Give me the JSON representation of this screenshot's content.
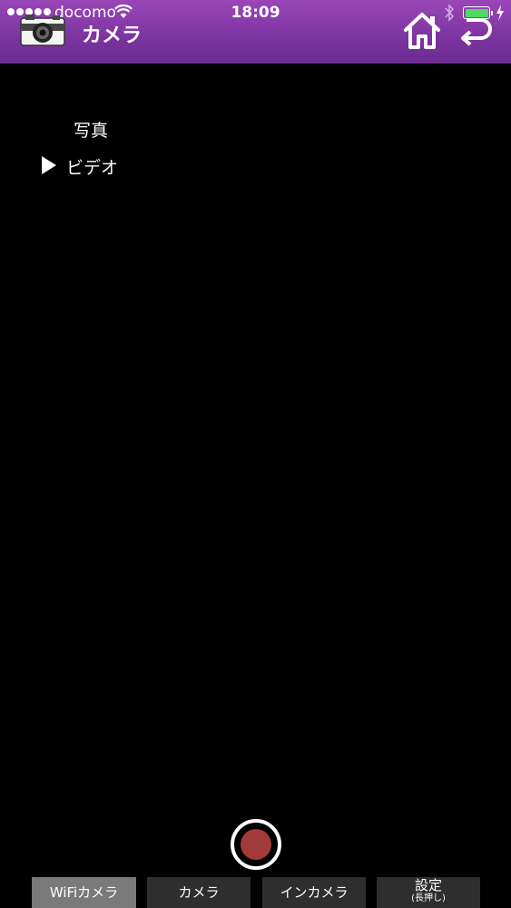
{
  "status_bar": {
    "carrier": "docomo",
    "time": "18:09",
    "battery_level": 1.0,
    "battery_color": "#4cd964"
  },
  "header": {
    "title": "カメラ",
    "background": "#7b34a0",
    "icons": [
      "camera-icon",
      "home-icon",
      "back-icon"
    ]
  },
  "mode_menu": {
    "items": [
      {
        "label": "写真",
        "selected": false
      },
      {
        "label": "ビデオ",
        "selected": true
      }
    ]
  },
  "record_button": {
    "color": "#a33a3a"
  },
  "tabs": [
    {
      "label": "WiFiカメラ",
      "active": true
    },
    {
      "label": "カメラ",
      "active": false
    },
    {
      "label": "インカメラ",
      "active": false
    },
    {
      "label": "設定",
      "sub": "(長押し)",
      "active": false
    }
  ]
}
